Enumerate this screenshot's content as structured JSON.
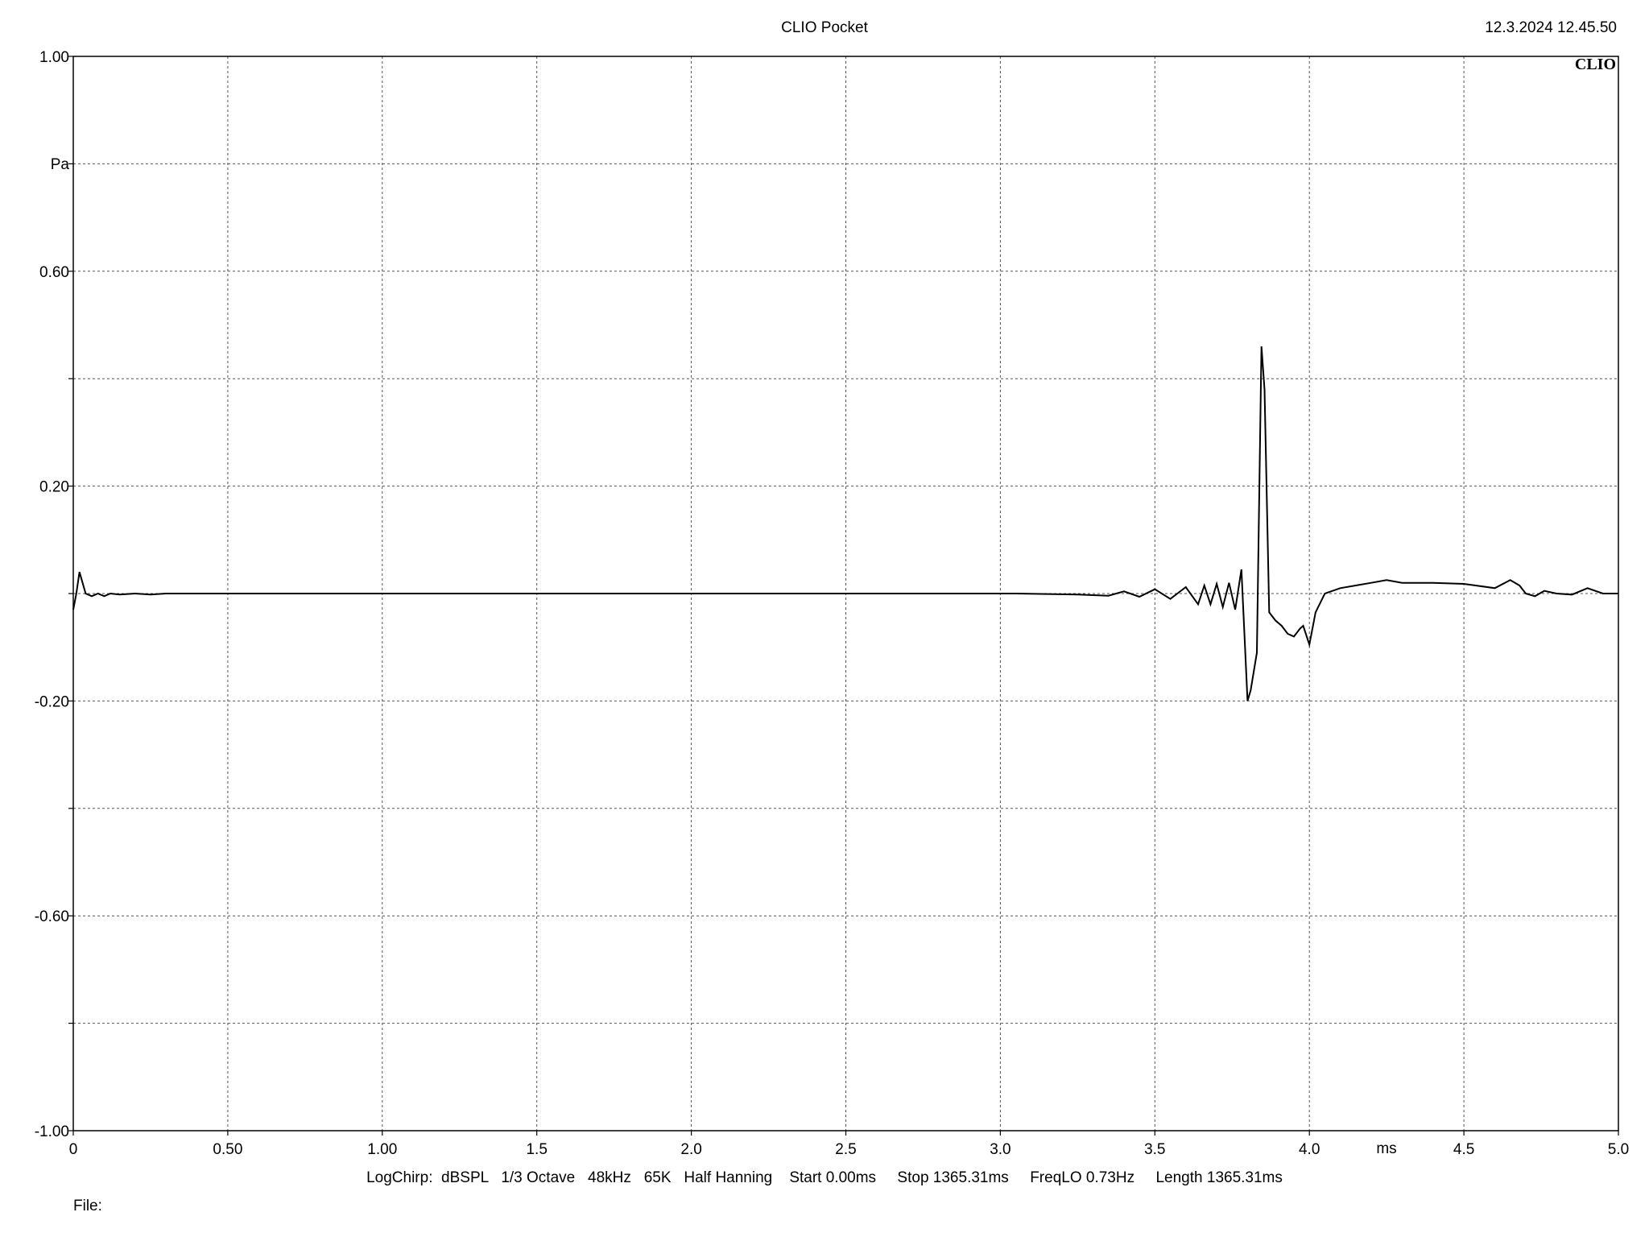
{
  "header": {
    "title": "CLIO Pocket",
    "timestamp": "12.3.2024 12.45.50",
    "brand": "CLIO"
  },
  "footer": {
    "params": "LogChirp:  dBSPL   1/3 Octave   48kHz   65K   Half Hanning    Start 0.00ms     Stop 1365.31ms     FreqLO 0.73Hz     Length 1365.31ms",
    "file_label": "File:"
  },
  "colors": {
    "trace": "#000000",
    "grid": "#555555",
    "background": "#ffffff"
  },
  "chart_data": {
    "type": "line",
    "title": "",
    "xlabel": "ms",
    "ylabel": "Pa",
    "xlim": [
      0,
      5.0
    ],
    "ylim": [
      -1.0,
      1.0
    ],
    "grid": true,
    "x_ticks": [
      {
        "v": 0,
        "label": "0"
      },
      {
        "v": 0.5,
        "label": "0.50"
      },
      {
        "v": 1.0,
        "label": "1.00"
      },
      {
        "v": 1.5,
        "label": "1.5"
      },
      {
        "v": 2.0,
        "label": "2.0"
      },
      {
        "v": 2.5,
        "label": "2.5"
      },
      {
        "v": 3.0,
        "label": "3.0"
      },
      {
        "v": 3.5,
        "label": "3.5"
      },
      {
        "v": 4.0,
        "label": "4.0"
      },
      {
        "v": 4.5,
        "label": "4.5"
      },
      {
        "v": 5.0,
        "label": "5.0"
      }
    ],
    "y_ticks": [
      {
        "v": 1.0,
        "label": "1.00"
      },
      {
        "v": 0.8,
        "label": ""
      },
      {
        "v": 0.6,
        "label": "0.60"
      },
      {
        "v": 0.4,
        "label": ""
      },
      {
        "v": 0.2,
        "label": "0.20"
      },
      {
        "v": 0.0,
        "label": ""
      },
      {
        "v": -0.2,
        "label": "-0.20"
      },
      {
        "v": -0.4,
        "label": ""
      },
      {
        "v": -0.6,
        "label": "-0.60"
      },
      {
        "v": -0.8,
        "label": ""
      },
      {
        "v": -1.0,
        "label": "-1.00"
      }
    ],
    "series": [
      {
        "x": [
          0,
          0.01,
          0.02,
          0.04,
          0.06,
          0.08,
          0.1,
          0.12,
          0.15,
          0.2,
          0.25,
          0.3,
          0.4,
          1.0,
          2.0,
          3.05,
          3.25,
          3.35,
          3.4,
          3.45,
          3.5,
          3.55,
          3.6,
          3.64,
          3.66,
          3.68,
          3.7,
          3.72,
          3.74,
          3.76,
          3.78,
          3.8,
          3.81,
          3.83,
          3.845,
          3.855,
          3.87,
          3.89,
          3.91,
          3.93,
          3.95,
          3.97,
          3.98,
          4.0,
          4.02,
          4.05,
          4.1,
          4.15,
          4.2,
          4.25,
          4.3,
          4.35,
          4.4,
          4.5,
          4.6,
          4.65,
          4.68,
          4.7,
          4.73,
          4.76,
          4.8,
          4.85,
          4.9,
          4.95,
          5.0
        ],
        "y": [
          -0.03,
          0.0,
          0.04,
          0.0,
          -0.005,
          0.0,
          -0.005,
          0.0,
          -0.002,
          0.0,
          -0.002,
          0.0,
          0.0,
          0.0,
          0.0,
          0.0,
          -0.002,
          -0.004,
          0.004,
          -0.006,
          0.008,
          -0.01,
          0.012,
          -0.02,
          0.015,
          -0.02,
          0.018,
          -0.025,
          0.02,
          -0.03,
          0.045,
          -0.2,
          -0.18,
          -0.11,
          0.46,
          0.38,
          -0.035,
          -0.05,
          -0.06,
          -0.075,
          -0.08,
          -0.065,
          -0.06,
          -0.095,
          -0.035,
          0.0,
          0.01,
          0.015,
          0.02,
          0.025,
          0.02,
          0.02,
          0.02,
          0.018,
          0.01,
          0.025,
          0.015,
          0.0,
          -0.005,
          0.005,
          0.0,
          -0.002,
          0.01,
          0.0,
          0.0
        ]
      }
    ]
  }
}
